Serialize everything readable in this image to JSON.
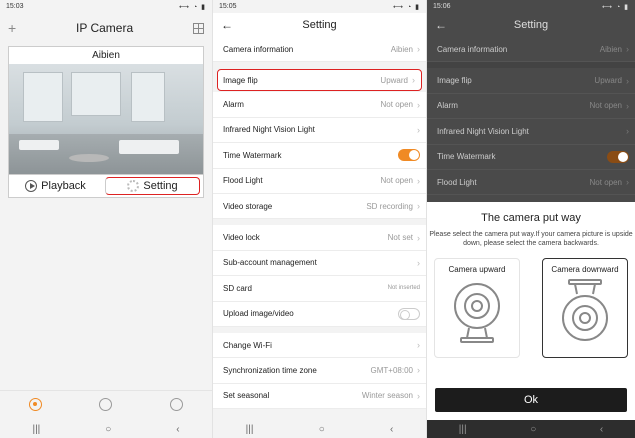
{
  "panel1": {
    "status_time": "15:03",
    "title": "IP Camera",
    "camera_name": "Aibien",
    "playback_label": "Playback",
    "setting_label": "Setting"
  },
  "panel2": {
    "status_time": "15:05",
    "title": "Setting",
    "rows": [
      {
        "label": "Camera information",
        "value": "Aibien"
      },
      {
        "label": "Image flip",
        "value": "Upward"
      },
      {
        "label": "Alarm",
        "value": "Not open"
      },
      {
        "label": "Infrared Night Vision Light",
        "value": ""
      },
      {
        "label": "Time Watermark",
        "value": ""
      },
      {
        "label": "Flood Light",
        "value": "Not open"
      },
      {
        "label": "Video storage",
        "value": "SD recording"
      },
      {
        "label": "Video lock",
        "value": "Not set"
      },
      {
        "label": "Sub-account management",
        "value": ""
      },
      {
        "label": "SD card",
        "value": "Not inserted"
      },
      {
        "label": "Upload image/video",
        "value": ""
      },
      {
        "label": "Change Wi-Fi",
        "value": ""
      },
      {
        "label": "Synchronization time zone",
        "value": "GMT+08:00"
      },
      {
        "label": "Set seasonal",
        "value": "Winter season"
      }
    ]
  },
  "panel3": {
    "status_time": "15:06",
    "title": "Setting",
    "rows": [
      {
        "label": "Camera information",
        "value": "Aibien"
      },
      {
        "label": "Image flip",
        "value": "Upward"
      },
      {
        "label": "Alarm",
        "value": "Not open"
      },
      {
        "label": "Infrared Night Vision Light",
        "value": ""
      },
      {
        "label": "Time Watermark",
        "value": ""
      },
      {
        "label": "Flood Light",
        "value": "Not open"
      }
    ],
    "sheet_title": "The camera put way",
    "sheet_desc": "Please select the camera put way.If your camera picture is upside down, please select the camera backwards.",
    "option_up": "Camera upward",
    "option_down": "Camera downward",
    "ok_label": "Ok"
  },
  "colors": {
    "accent": "#f08a24",
    "highlight": "#dd2222"
  }
}
